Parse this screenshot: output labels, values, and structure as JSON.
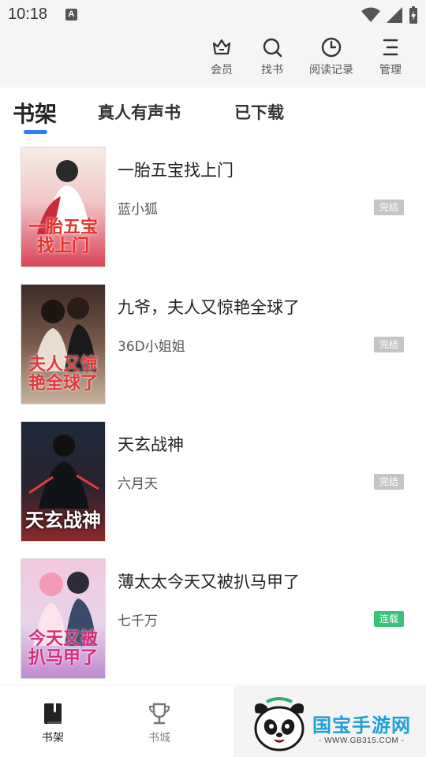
{
  "status_bar": {
    "time": "10:18",
    "notification_icon": "A",
    "icons": [
      "wifi-icon",
      "signal-icon",
      "battery-charging-icon"
    ]
  },
  "toolbar": {
    "items": [
      {
        "label": "会员",
        "icon": "crown-icon"
      },
      {
        "label": "找书",
        "icon": "search-icon"
      },
      {
        "label": "阅读记录",
        "icon": "clock-icon"
      },
      {
        "label": "管理",
        "icon": "menu-icon"
      }
    ]
  },
  "tabs": {
    "active": "书架",
    "items": [
      "书架",
      "真人有声书",
      "已下载"
    ]
  },
  "books": [
    {
      "title": "一胎五宝找上门",
      "author": "蓝小狐",
      "status": "完结",
      "status_type": "finished",
      "cover_text": "一胎五宝找上门",
      "cover_colors": [
        "#f7ece4",
        "#d9455a"
      ]
    },
    {
      "title": "九爷，夫人又惊艳全球了",
      "author": "36D小姐姐",
      "status": "完结",
      "status_type": "finished",
      "cover_text": "夫人又惊艳全球了",
      "cover_colors": [
        "#5a3a34",
        "#c8b49e"
      ]
    },
    {
      "title": "天玄战神",
      "author": "六月天",
      "status": "完结",
      "status_type": "finished",
      "cover_text": "天玄战神",
      "cover_colors": [
        "#1d2a3a",
        "#8a2a2a"
      ]
    },
    {
      "title": "薄太太今天又被扒马甲了",
      "author": "七千万",
      "status": "连载",
      "status_type": "ongoing",
      "cover_text": "今天又被扒马甲了",
      "cover_colors": [
        "#f3c9de",
        "#c08ad0"
      ]
    }
  ],
  "bottom_nav": {
    "items": [
      {
        "label": "书架",
        "icon": "bookshelf-icon",
        "active": true
      },
      {
        "label": "书城",
        "icon": "trophy-icon",
        "active": false
      }
    ]
  },
  "watermark": {
    "text": "国宝手游网",
    "url": "- WWW.GB315.COM -"
  },
  "colors": {
    "accent": "#2f7ef7",
    "badge_finished": "#c4c4c4",
    "badge_ongoing": "#3cc17a",
    "toolbar_bg": "#f5f5f5"
  }
}
